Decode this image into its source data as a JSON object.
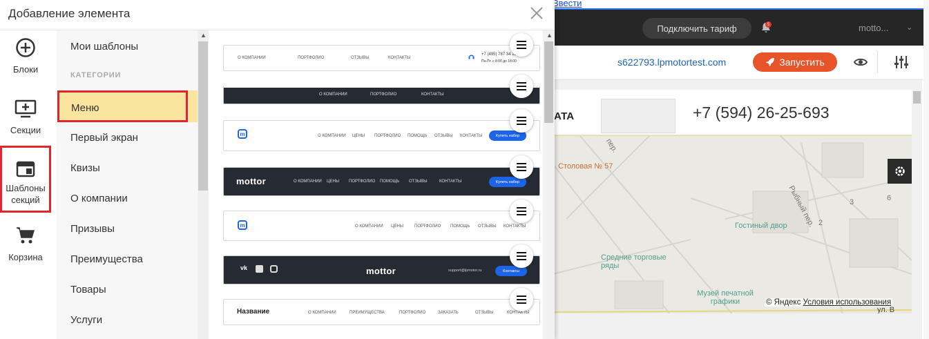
{
  "dialog": {
    "title": "Добавление элемента"
  },
  "rail": [
    {
      "id": "blocks",
      "label": "Блоки",
      "icon": "plus-circle-icon"
    },
    {
      "id": "sections",
      "label": "Секции",
      "icon": "add-section-icon"
    },
    {
      "id": "section-templates",
      "label": "Шаблоны секций",
      "label_line1": "Шаблоны",
      "label_line2": "секций",
      "icon": "section-template-icon",
      "active": true
    },
    {
      "id": "cart",
      "label": "Корзина",
      "icon": "cart-icon"
    }
  ],
  "categories": {
    "my_templates": "Мои шаблоны",
    "header": "КАТЕГОРИИ",
    "items": [
      "Меню",
      "Первый экран",
      "Квизы",
      "О компании",
      "Призывы",
      "Преимущества",
      "Товары",
      "Услуги"
    ],
    "selected": "Меню"
  },
  "templates": [
    {
      "theme": "light",
      "nav": [
        "О КОМПАНИИ",
        "ПОРТФОЛИО",
        "ОТЗЫВЫ",
        "КОНТАКТЫ"
      ],
      "phone": "+7 (495) 787 34 25",
      "hours": "Пн-Пт. с 8:00 до 18:00"
    },
    {
      "theme": "dark",
      "nav": [
        "О КОМПАНИИ",
        "ПОРТФОЛИО",
        "КОНТАКТЫ"
      ]
    },
    {
      "theme": "light",
      "nav": [
        "О КОМПАНИИ",
        "ЦЕНЫ",
        "ПОРТФОЛИО",
        "ПОМОЩЬ",
        "ОТЗЫВЫ",
        "КОНТАКТЫ"
      ],
      "cta": "Купить набор"
    },
    {
      "theme": "dark",
      "brand": "mottor",
      "nav": [
        "О КОМПАНИИ",
        "ЦЕНЫ",
        "ПОРТФОЛИО",
        "ПОМОЩЬ",
        "ОТЗЫВЫ",
        "КОНТАКТЫ"
      ],
      "cta": "Купить набор"
    },
    {
      "theme": "light",
      "nav": [
        "О КОМПАНИИ",
        "ЦЕНЫ",
        "ПОРТФОЛИО",
        "ПОМОЩЬ",
        "ОТЗЫВЫ",
        "КОНТАКТЫ"
      ]
    },
    {
      "theme": "dark",
      "brand": "mottor",
      "email": "support@lpmotor.ru",
      "cta": "Контакты"
    },
    {
      "theme": "light",
      "name": "Название",
      "nav": [
        "О КОМПАНИИ",
        "ПРЕИМУЩЕСТВА",
        "ПОРТФОЛИО",
        "ЗАКАЗАТЬ",
        "ОТЗЫВЫ",
        "КОНТАКТЫ"
      ]
    }
  ],
  "editor": {
    "top_link": "Ввести",
    "plan_button": "Подключить тариф",
    "notification_count": "5",
    "account": "motto...",
    "domain": "s622793.lpmotortest.com",
    "launch_button": "Запустить",
    "logo_partial": "АТА",
    "phone": "+7 (594) 26-25-693",
    "map": {
      "labels": [
        "Столовая № 57",
        "Рыбный пер.",
        "Гостиный двор",
        "Средние торговые ряды",
        "Музей печатной графики",
        "ул. В"
      ],
      "street_label": "пер.",
      "building_numbers": [
        "3",
        "6",
        "2"
      ],
      "copyright": "© Яндекс",
      "terms": "Условия использования"
    }
  },
  "colors": {
    "accent_red": "#e0262b",
    "selected_bg": "#fae49e",
    "launch_orange": "#e8542a",
    "cta_blue": "#1e64e8",
    "link_blue": "#1e63b8"
  }
}
